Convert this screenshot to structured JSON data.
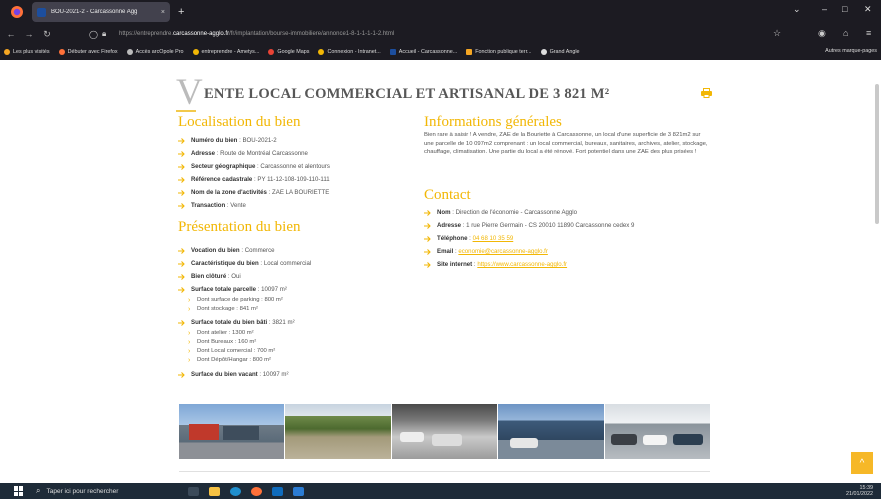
{
  "browser": {
    "tab_title": "BOU-2021-2 - Carcassonne Agg",
    "tab_close": "×",
    "new_tab": "+",
    "url_prefix": "https://entreprendre.",
    "url_host": "carcassonne-agglo.fr",
    "url_path": "/fr/implantation/bourse-immobiliere/annonce1-8-1-1-1-1-2.html",
    "bookmarks": [
      "Les plus visités",
      "Débuter avec Firefox",
      "Accès arcOpole Pro",
      "entreprendre - Ametys...",
      "Google Maps",
      "Connexion - Intranet...",
      "Accueil - Carcassonne...",
      "Fonction publique terr...",
      "Grand Angle"
    ],
    "other_bookmarks": "Autres marque-pages"
  },
  "page": {
    "big_letter": "V",
    "title": "ENTE LOCAL COMMERCIAL ET ARTISANAL DE 3 821 M²",
    "localisation": {
      "heading": "Localisation du bien",
      "items": [
        {
          "label": "Numéro du bien",
          "value": " : BOU-2021-2"
        },
        {
          "label": "Adresse",
          "value": " : Route de Montréal Carcassonne"
        },
        {
          "label": "Secteur géographique",
          "value": " : Carcassonne et alentours"
        },
        {
          "label": "Référence cadastrale",
          "value": " : PY 11-12-108-109-110-111"
        },
        {
          "label": "Nom de la zone d'activités",
          "value": " : ZAE LA BOURIETTE"
        },
        {
          "label": "Transaction",
          "value": " : Vente"
        }
      ]
    },
    "presentation": {
      "heading": "Présentation du bien",
      "vocation": {
        "label": "Vocation du bien",
        "value": " : Commerce"
      },
      "caracteristique": {
        "label": "Caractéristique du bien",
        "value": " : Local commercial"
      },
      "cloture": {
        "label": "Bien clôturé",
        "value": " : Oui"
      },
      "parcelle": {
        "label": "Surface totale parcelle",
        "value": " : 10097 m²"
      },
      "parcelle_sub": [
        "Dont surface de parking : 800 m²",
        "Dont stockage : 841 m²"
      ],
      "bati": {
        "label": "Surface totale du bien bâti",
        "value": " : 3821 m²"
      },
      "bati_sub": [
        "Dont atelier : 1300 m²",
        "Dont Bureaux : 160 m²",
        "Dont Local comercial : 700 m²",
        "Dont Dépôt/Hangar : 800 m²"
      ],
      "vacant": {
        "label": "Surface du bien vacant",
        "value": " : 10097 m²"
      }
    },
    "informations": {
      "heading": "Informations générales",
      "text": "Bien rare à saisir ! A vendre, ZAE de la Bouriette à Carcassonne, un local d'une superficie de 3 821m2 sur une parcelle de 10 097m2 comprenant : un local commercial, bureaux, sanitaires, archives, atelier, stockage, chauffage, climatisation. Une partie du local a été rénové. Fort potentiel dans une ZAE des plus prisées !"
    },
    "contact": {
      "heading": "Contact",
      "nom": {
        "label": "Nom",
        "value": " : Direction de l'économie - Carcassonne Agglo"
      },
      "adresse": {
        "label": "Adresse",
        "value": " : 1 rue Pierre Germain - CS 20010 11890 Carcassonne cedex 9"
      },
      "telephone": {
        "label": "Téléphone",
        "sep": " : ",
        "link": "04 68 10 35 59"
      },
      "email": {
        "label": "Email",
        "sep": " : ",
        "link": "economie@carcassonne-agglo.fr"
      },
      "site": {
        "label": "Site internet",
        "sep": " : ",
        "link": "https://www.carcassonne-agglo.fr"
      }
    },
    "scroll_top": "^"
  },
  "taskbar": {
    "search": "Taper ici pour rechercher",
    "time": "15:39",
    "date": "21/01/2022"
  },
  "colors": {
    "accent": "#f2b705",
    "chrome": "#1c1b22",
    "taskbar": "#1e2b38"
  },
  "icons": [
    "firefox-icon",
    "back-icon",
    "forward-icon",
    "reload-icon",
    "shield-icon",
    "lock-icon",
    "star-icon",
    "pocket-icon",
    "extensions-icon",
    "menu-icon",
    "print-icon",
    "arrow-bullet-icon",
    "chevron-icon",
    "windows-icon",
    "search-icon"
  ]
}
